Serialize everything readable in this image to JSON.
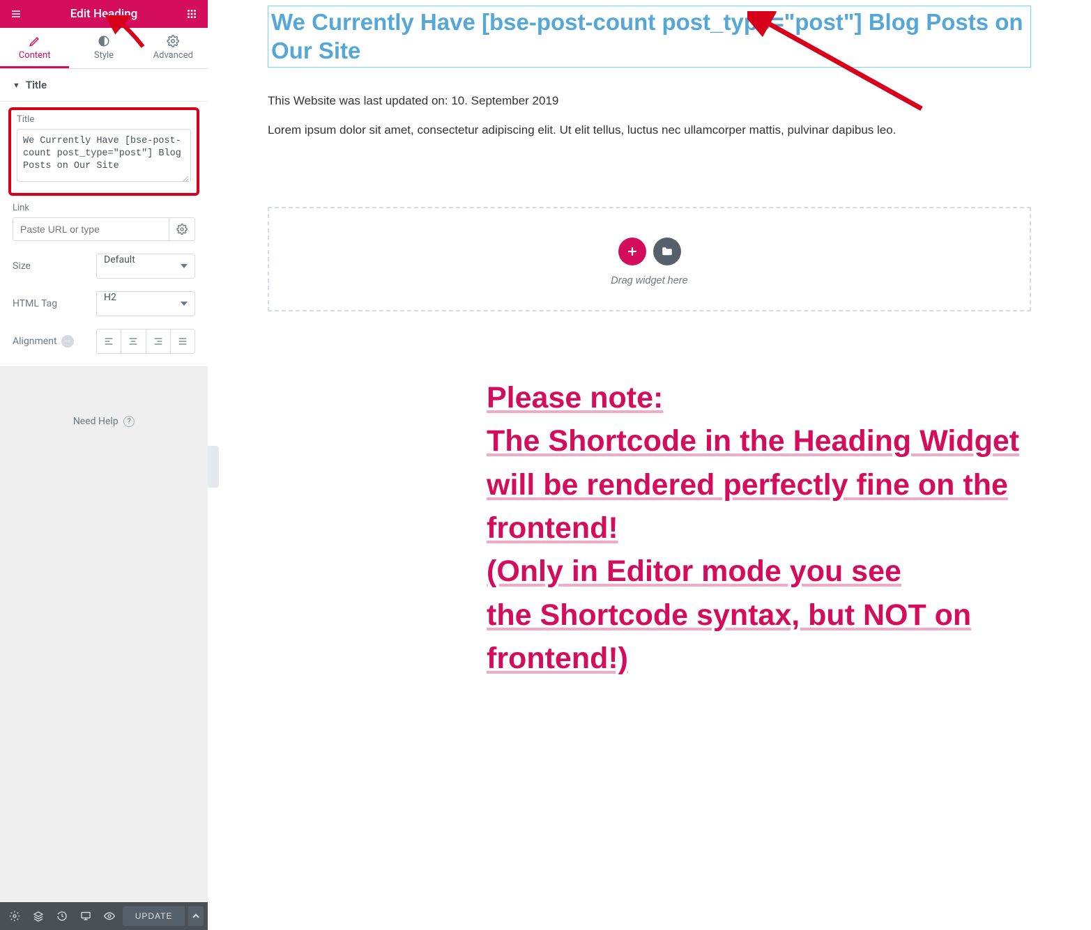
{
  "header": {
    "title": "Edit Heading"
  },
  "tabs": {
    "content": "Content",
    "style": "Style",
    "advanced": "Advanced"
  },
  "section": {
    "title": "Title"
  },
  "title_field": {
    "label": "Title",
    "value": "We Currently Have [bse-post-count post_type=\"post\"] Blog Posts on Our Site"
  },
  "link": {
    "label": "Link",
    "placeholder": "Paste URL or type"
  },
  "size": {
    "label": "Size",
    "value": "Default"
  },
  "htmltag": {
    "label": "HTML Tag",
    "value": "H2"
  },
  "alignment": {
    "label": "Alignment"
  },
  "help": "Need Help",
  "bottom": {
    "update": "UPDATE"
  },
  "canvas": {
    "heading": "We Currently Have [bse-post-count post_type=\"post\"] Blog Posts on Our Site",
    "updated": "This Website was last updated on: 10. September 2019",
    "lorem": "Lorem ipsum dolor sit amet, consectetur adipiscing elit. Ut elit tellus, luctus nec ullamcorper mattis, pulvinar dapibus leo.",
    "dropzone": "Drag widget here"
  },
  "annotation": {
    "l1": "Please note:",
    "l2": "The Shortcode in the Heading Widget",
    "l3": "will be rendered perfectly fine on the frontend!",
    "l4": "(Only in Editor mode you see",
    "l5": "the Shortcode syntax, but NOT on frontend!)"
  }
}
